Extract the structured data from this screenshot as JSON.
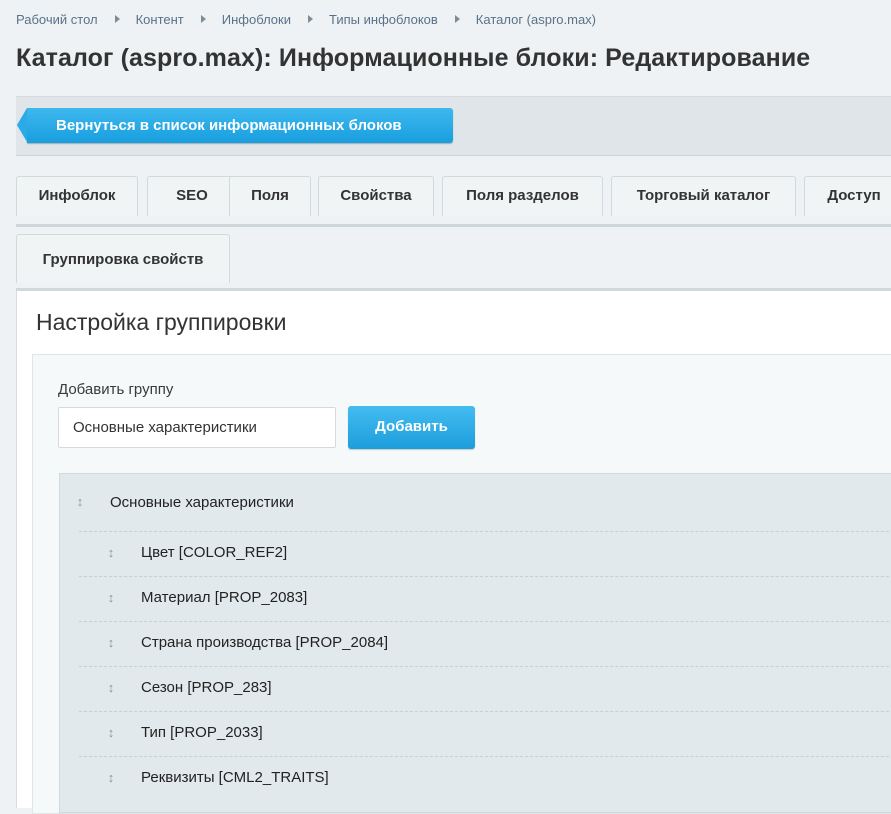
{
  "breadcrumbs": [
    "Рабочий стол",
    "Контент",
    "Инфоблоки",
    "Типы инфоблоков",
    "Каталог (aspro.max)"
  ],
  "page_title": "Каталог (aspro.max): Информационные блоки: Редактирование",
  "back_button_label": "Вернуться в список информационных блоков",
  "tabs": [
    "Инфоблок",
    "SEO",
    "Поля",
    "Свойства",
    "Поля разделов",
    "Торговый каталог",
    "Доступ"
  ],
  "tabs_row2": [
    "Группировка свойств"
  ],
  "section_title": "Настройка группировки",
  "add_group": {
    "label": "Добавить группу",
    "input_value": "Основные характеристики",
    "button_label": "Добавить"
  },
  "group": {
    "title": "Основные характеристики",
    "properties": [
      "Цвет [COLOR_REF2]",
      "Материал [PROP_2083]",
      "Страна производства [PROP_2084]",
      "Сезон [PROP_283]",
      "Тип [PROP_2033]",
      "Реквизиты [CML2_TRAITS]"
    ]
  },
  "icons": {
    "drag": "drag-handle-icon",
    "breadcrumb_separator": "chevron-right-icon"
  },
  "colors": {
    "accent": "#1ea7e4",
    "link": "#5a7189",
    "background": "#eef2f4"
  }
}
